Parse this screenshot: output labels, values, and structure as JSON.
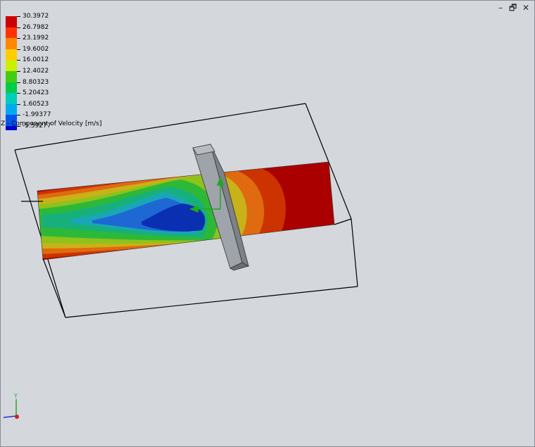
{
  "window": {
    "controls": {
      "minimize": "–",
      "restore": "🗗",
      "close": "✕"
    }
  },
  "legend": {
    "title": "Z - Component of Velocity [m/s]",
    "entries": [
      {
        "value": "30.3972",
        "color": "#cc0000"
      },
      {
        "value": "26.7982",
        "color": "#ff3300"
      },
      {
        "value": "23.1992",
        "color": "#ff8800"
      },
      {
        "value": "19.6002",
        "color": "#ffcc00"
      },
      {
        "value": "16.0012",
        "color": "#ccee00"
      },
      {
        "value": "12.4022",
        "color": "#44cc11"
      },
      {
        "value": "8.80323",
        "color": "#00cc44"
      },
      {
        "value": "5.20423",
        "color": "#00ccbb"
      },
      {
        "value": "1.60523",
        "color": "#00aaee"
      },
      {
        "value": "-1.99377",
        "color": "#0055ee"
      },
      {
        "value": "-5.59277",
        "color": "#0000cc"
      }
    ]
  },
  "triad": {
    "y_label": "Y",
    "x_color": "#2233dd",
    "y_color": "#22aa22",
    "origin_color": "#cc2222"
  },
  "palette": {
    "background": "#d4d7dc",
    "box_edge": "#000000",
    "obstacle": "#a0a4ab"
  }
}
